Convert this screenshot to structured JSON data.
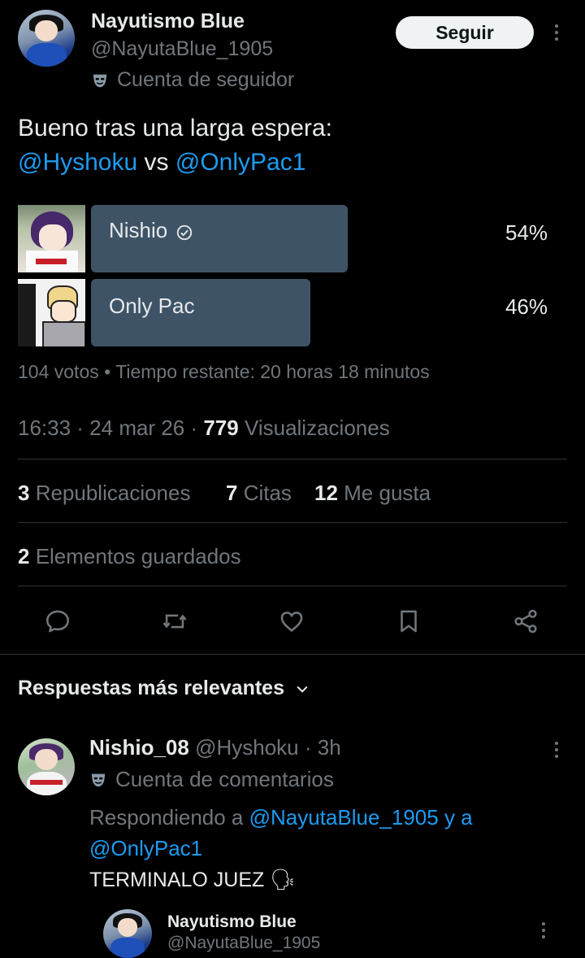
{
  "tweet": {
    "author": {
      "name": "Nayutismo Blue",
      "handle": "@NayutaBlue_1905",
      "badge_icon": "mask-icon",
      "badge_label": "Cuenta de seguidor"
    },
    "follow_label": "Seguir",
    "text_line1": "Bueno tras una larga espera:",
    "mention1": "@Hyshoku",
    "vs": "vs",
    "mention2": "@OnlyPac1",
    "poll": {
      "options": [
        {
          "label": "Nishio",
          "percent": "54%",
          "fraction": 0.54,
          "selected": true
        },
        {
          "label": "Only Pac",
          "percent": "46%",
          "fraction": 0.46,
          "selected": false
        }
      ],
      "meta": "104 votos • Tiempo restante: 20 horas 18 minutos"
    },
    "timestamp": "16:33 · 24 mar 26 · ",
    "views_count": "779",
    "views_label": " Visualizaciones",
    "stats": {
      "reposts_count": "3",
      "reposts_label": " Republicaciones",
      "quotes_count": "7",
      "quotes_label": " Citas",
      "likes_count": "12",
      "likes_label": " Me gusta",
      "saves_count": "2",
      "saves_label": " Elementos guardados"
    },
    "actions": [
      "reply-icon",
      "retweet-icon",
      "like-icon",
      "bookmark-icon",
      "share-icon"
    ]
  },
  "replies": {
    "sort_label": "Respuestas más relevantes",
    "items": [
      {
        "name": "Nishio_08",
        "handle": "@Hyshoku",
        "time": " · 3h",
        "badge_label": "Cuenta de comentarios",
        "replying_prefix": "Respondiendo a ",
        "replying_to1": "@NayutaBlue_1905",
        "replying_and": " y a",
        "replying_to2": "@OnlyPac1",
        "text": "TERMINALO JUEZ",
        "emoji": "🗣"
      }
    ],
    "next_author": {
      "name": "Nayutismo Blue",
      "handle": "@NayutaBlue_1905"
    }
  },
  "colors": {
    "background": "#000000",
    "text": "#e7e9ea",
    "muted": "#71767b",
    "link": "#1d9bf0",
    "poll_bar": "#3e5366",
    "follow_button": "#eff3f4"
  }
}
